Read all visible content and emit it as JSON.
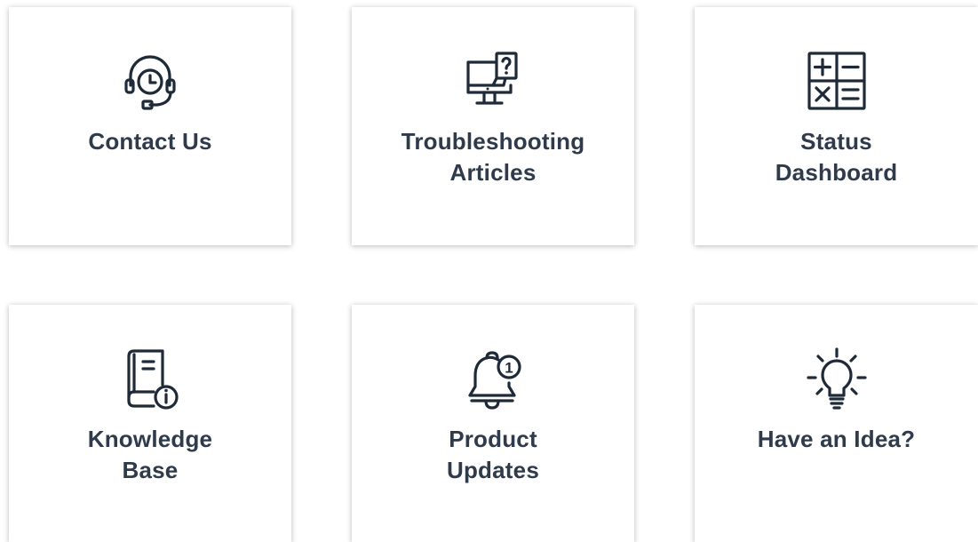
{
  "cards": [
    {
      "id": "contact-us",
      "icon": "headset-clock-icon",
      "lines": [
        "Contact Us"
      ]
    },
    {
      "id": "troubleshooting-articles",
      "icon": "monitor-question-icon",
      "lines": [
        "Troubleshooting",
        "Articles"
      ]
    },
    {
      "id": "status-dashboard",
      "icon": "calculator-icon",
      "lines": [
        "Status",
        "Dashboard"
      ]
    },
    {
      "id": "knowledge-base",
      "icon": "book-info-icon",
      "lines": [
        "Knowledge",
        "Base"
      ]
    },
    {
      "id": "product-updates",
      "icon": "bell-notification-icon",
      "lines": [
        "Product",
        "Updates"
      ],
      "badge": "1"
    },
    {
      "id": "have-an-idea",
      "icon": "lightbulb-icon",
      "lines": [
        "Have an Idea?"
      ]
    }
  ],
  "colors": {
    "text": "#2f3a4b",
    "icon": "#1f2a38",
    "card_bg": "#ffffff"
  }
}
